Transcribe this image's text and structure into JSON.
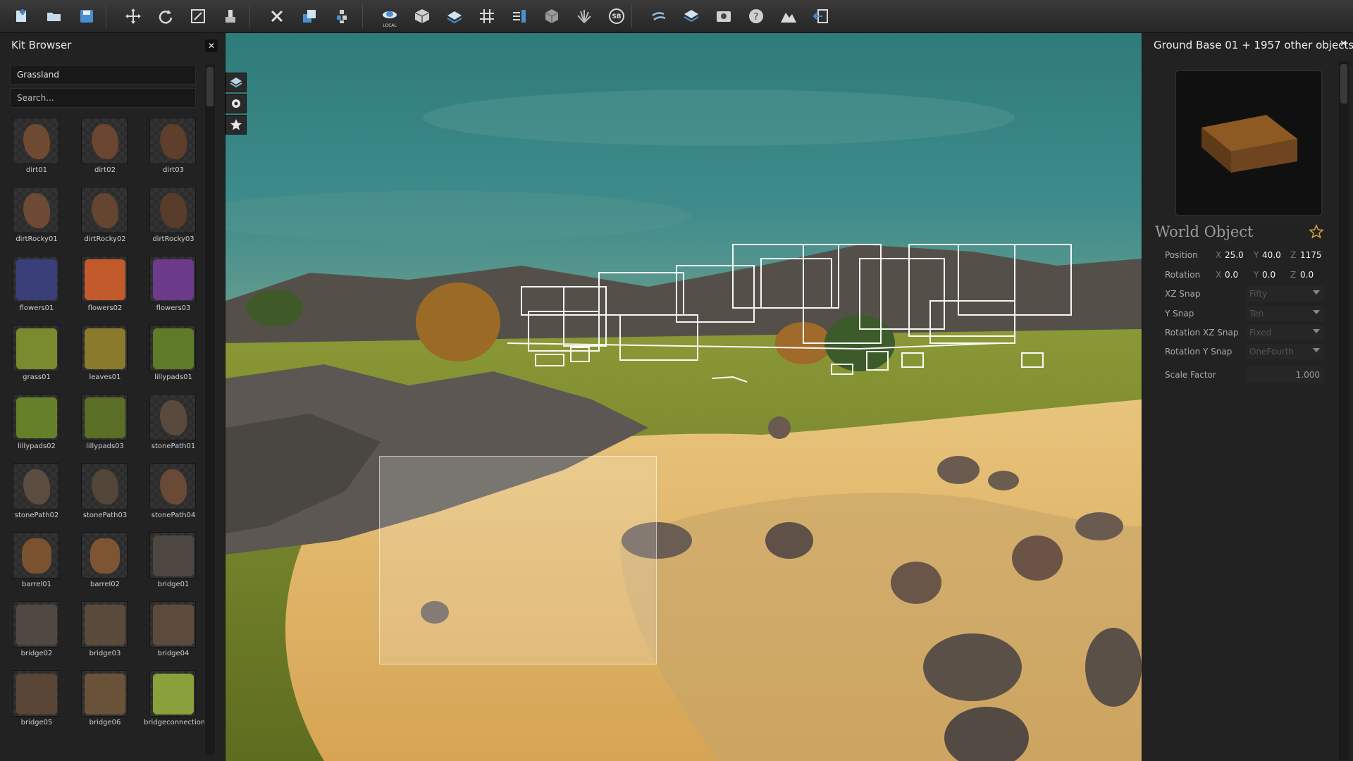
{
  "kit_browser": {
    "title": "Kit Browser",
    "category": "Grassland",
    "search_placeholder": "Search...",
    "items": [
      {
        "label": "dirt01",
        "color": "#6e4a32"
      },
      {
        "label": "dirt02",
        "color": "#6a4630"
      },
      {
        "label": "dirt03",
        "color": "#5e3f2b"
      },
      {
        "label": "dirtRocky01",
        "color": "#6d4a33"
      },
      {
        "label": "dirtRocky02",
        "color": "#654430"
      },
      {
        "label": "dirtRocky03",
        "color": "#583b28"
      },
      {
        "label": "flowers01",
        "color": "#3a3f7a"
      },
      {
        "label": "flowers02",
        "color": "#c25a2c"
      },
      {
        "label": "flowers03",
        "color": "#6b3a8a"
      },
      {
        "label": "grass01",
        "color": "#7a8a2e"
      },
      {
        "label": "leaves01",
        "color": "#8a7a2c"
      },
      {
        "label": "lillypads01",
        "color": "#5f7a28"
      },
      {
        "label": "lillypads02",
        "color": "#66802a"
      },
      {
        "label": "lillypads03",
        "color": "#5a6e26"
      },
      {
        "label": "stonePath01",
        "color": "#5a4a3e"
      },
      {
        "label": "stonePath02",
        "color": "#5d4d40"
      },
      {
        "label": "stonePath03",
        "color": "#544539"
      },
      {
        "label": "stonePath04",
        "color": "#6a4a36"
      },
      {
        "label": "barrel01",
        "color": "#7a5230"
      },
      {
        "label": "barrel02",
        "color": "#7d5533"
      },
      {
        "label": "bridge01",
        "color": "#4e4640"
      },
      {
        "label": "bridge02",
        "color": "#514843"
      },
      {
        "label": "bridge03",
        "color": "#5a4a3c"
      },
      {
        "label": "bridge04",
        "color": "#5c4b3c"
      },
      {
        "label": "bridge05",
        "color": "#5a4636"
      },
      {
        "label": "bridge06",
        "color": "#6a5239"
      },
      {
        "label": "bridgeconnection01",
        "color": "#8aa03a"
      }
    ]
  },
  "toolbar": {
    "buttons": [
      {
        "name": "new-scene-icon"
      },
      {
        "name": "open-folder-icon"
      },
      {
        "name": "save-icon"
      },
      {
        "name": "move-tool-icon"
      },
      {
        "name": "rotate-tool-icon"
      },
      {
        "name": "scale-tool-icon"
      },
      {
        "name": "paint-tool-icon"
      },
      {
        "name": "delete-icon"
      },
      {
        "name": "duplicate-icon"
      },
      {
        "name": "align-icon"
      },
      {
        "name": "local-space-icon",
        "label": "LOCAL"
      },
      {
        "name": "snap-object-icon"
      },
      {
        "name": "snap-surface-icon"
      },
      {
        "name": "grid-icon"
      },
      {
        "name": "measure-icon"
      },
      {
        "name": "cube-icon"
      },
      {
        "name": "foliage-icon"
      },
      {
        "name": "sb-icon",
        "label": "SB"
      },
      {
        "name": "wind-icon"
      },
      {
        "name": "layers-icon"
      },
      {
        "name": "camera-icon"
      },
      {
        "name": "help-icon"
      },
      {
        "name": "terrain-icon"
      },
      {
        "name": "exit-icon"
      }
    ]
  },
  "inspector": {
    "title": "Ground Base 01 + 1957 other objects",
    "object_type": "World Object",
    "position_label": "Position",
    "rotation_label": "Rotation",
    "position": {
      "x": "25.0",
      "y": "40.0",
      "z": "1175"
    },
    "rotation": {
      "x": "0.0",
      "y": "0.0",
      "z": "0.0"
    },
    "axis_x": "X",
    "axis_y": "Y",
    "axis_z": "Z",
    "xz_snap_label": "XZ Snap",
    "xz_snap": "Fifty",
    "y_snap_label": "Y Snap",
    "y_snap": "Ten",
    "rot_xz_snap_label": "Rotation XZ Snap",
    "rot_xz_snap": "Fixed",
    "rot_y_snap_label": "Rotation Y Snap",
    "rot_y_snap": "OneFourth",
    "scale_factor_label": "Scale Factor",
    "scale_factor": "1.000"
  },
  "colors": {
    "sky": "#2f7f7e",
    "sand": "#e2b86a",
    "grass": "#7a8a2a",
    "rock": "#5a5450",
    "wireframe": "#ffffff",
    "favorite_star": "#d7a43a"
  }
}
